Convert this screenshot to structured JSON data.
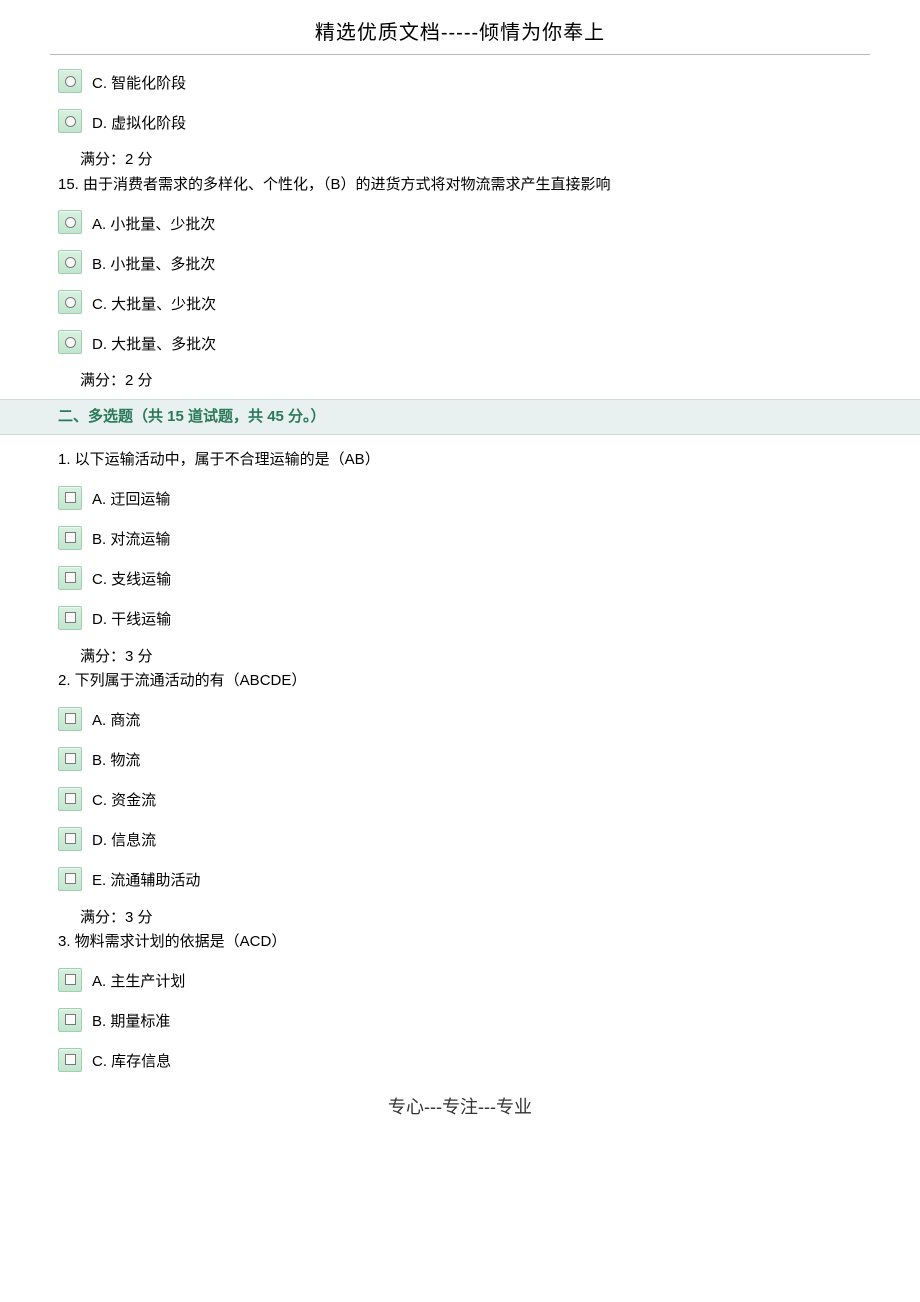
{
  "header": "精选优质文档-----倾情为你奉上",
  "footer": "专心---专注---专业",
  "q14_tail_options": [
    {
      "label": "C. 智能化阶段"
    },
    {
      "label": "D. 虚拟化阶段"
    }
  ],
  "q14_score": "满分：2 分",
  "q15": {
    "text": "15.  由于消费者需求的多样化、个性化，（B）的进货方式将对物流需求产生直接影响",
    "options": [
      {
        "label": "A. 小批量、少批次"
      },
      {
        "label": "B. 小批量、多批次"
      },
      {
        "label": "C. 大批量、少批次"
      },
      {
        "label": "D. 大批量、多批次"
      }
    ],
    "score": "满分：2 分"
  },
  "section2": {
    "title": "二、多选题（共 15 道试题，共 45 分。）"
  },
  "mq1": {
    "text": "1.  以下运输活动中，属于不合理运输的是（AB）",
    "options": [
      {
        "label": "A. 迂回运输"
      },
      {
        "label": "B. 对流运输"
      },
      {
        "label": "C. 支线运输"
      },
      {
        "label": "D. 干线运输"
      }
    ],
    "score": "满分：3 分"
  },
  "mq2": {
    "text": "2.  下列属于流通活动的有（ABCDE）",
    "options": [
      {
        "label": "A. 商流"
      },
      {
        "label": "B. 物流"
      },
      {
        "label": "C. 资金流"
      },
      {
        "label": "D. 信息流"
      },
      {
        "label": "E. 流通辅助活动"
      }
    ],
    "score": "满分：3 分"
  },
  "mq3": {
    "text": "3.  物料需求计划的依据是（ACD）",
    "options": [
      {
        "label": "A. 主生产计划"
      },
      {
        "label": "B. 期量标准"
      },
      {
        "label": "C. 库存信息"
      }
    ]
  }
}
